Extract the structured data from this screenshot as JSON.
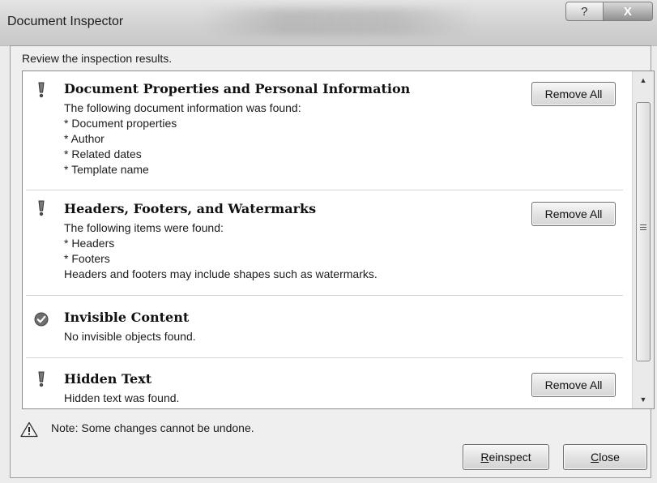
{
  "window": {
    "title": "Document Inspector",
    "help_glyph": "?",
    "close_glyph": "X"
  },
  "instructions": "Review the inspection results.",
  "sections": [
    {
      "title": "Document Properties and Personal Information",
      "status": "issue",
      "icon": "exclamation-icon",
      "lines": [
        "The following document information was found:",
        "* Document properties",
        "* Author",
        "* Related dates",
        "* Template name"
      ],
      "button": "Remove All"
    },
    {
      "title": "Headers, Footers, and Watermarks",
      "status": "issue",
      "icon": "exclamation-icon",
      "lines": [
        "The following items were found:",
        "* Headers",
        "* Footers",
        "Headers and footers may include shapes such as watermarks."
      ],
      "button": "Remove All"
    },
    {
      "title": "Invisible Content",
      "status": "ok",
      "icon": "checkmark-icon",
      "lines": [
        "No invisible objects found."
      ]
    },
    {
      "title": "Hidden Text",
      "status": "issue",
      "icon": "exclamation-icon",
      "lines": [
        "Hidden text was found."
      ],
      "button": "Remove All"
    }
  ],
  "note": "Note: Some changes cannot be undone.",
  "footer": {
    "reinspect_mnemonic": "R",
    "reinspect_rest": "einspect",
    "close_mnemonic": "C",
    "close_rest": "lose"
  }
}
